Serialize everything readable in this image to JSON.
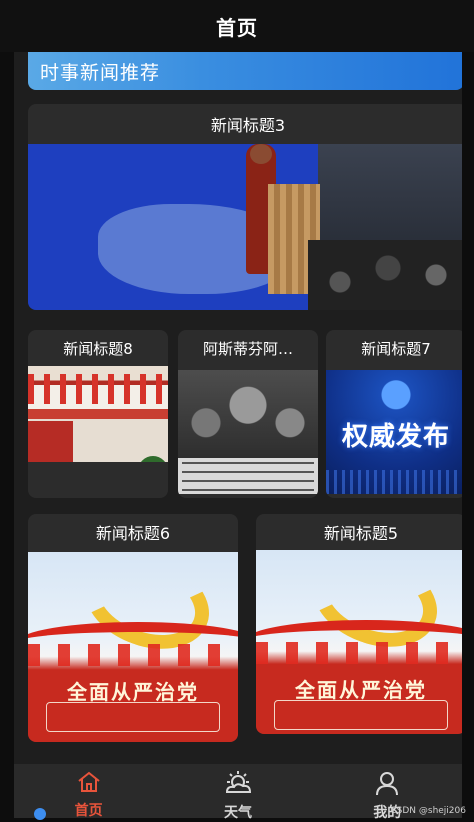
{
  "header": {
    "title": "首页"
  },
  "banner": {
    "text": "时事新闻推荐"
  },
  "cards": [
    {
      "title": "新闻标题3",
      "image": "podium-speech-photo"
    },
    {
      "title": "新闻标题8",
      "image": "red-hall-photo"
    },
    {
      "title": "阿斯蒂芬阿…",
      "image": "historical-crowd-photo"
    },
    {
      "title": "新闻标题7",
      "image": "authority-release-poster",
      "poster_text": "权威发布"
    },
    {
      "title": "新闻标题6",
      "image": "party-poster",
      "poster_text": "全面从严治党"
    },
    {
      "title": "新闻标题5",
      "image": "party-poster",
      "poster_text": "全面从严治党"
    }
  ],
  "tabbar": {
    "items": [
      {
        "label": "首页",
        "icon": "home-icon",
        "active": true
      },
      {
        "label": "天气",
        "icon": "weather-icon",
        "active": false
      },
      {
        "label": "我的",
        "icon": "user-icon",
        "active": false
      }
    ]
  },
  "watermark": "CSDN @sheji206",
  "colors": {
    "accent": "#e8543b",
    "banner": "#2173d9",
    "card": "#2c2c2c",
    "background": "#1e1e1e"
  }
}
